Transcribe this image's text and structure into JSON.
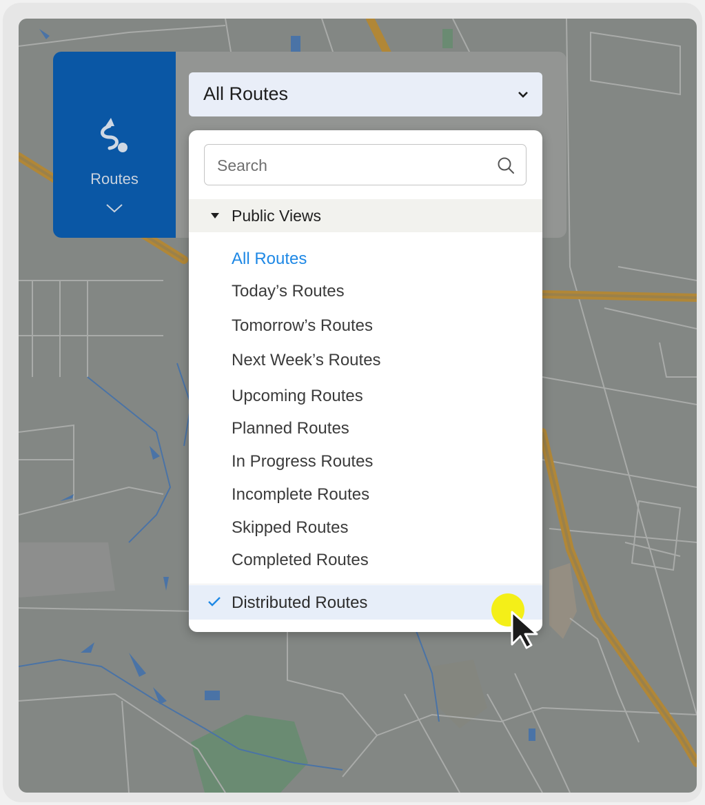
{
  "panel": {
    "tab_label": "Routes",
    "tab_icon": "route-icon",
    "tab_chevron_icon": "chevron-down-icon"
  },
  "select": {
    "value": "All Routes",
    "chevron_icon": "chevron-down-icon"
  },
  "dropdown": {
    "search_placeholder": "Search",
    "search_icon": "search-icon",
    "group_label": "Public Views",
    "options": [
      "All Routes",
      "Today’s Routes",
      "Tomorrow’s Routes",
      "Next Week’s Routes",
      "Upcoming Routes",
      "Planned Routes",
      "In Progress Routes",
      "Incomplete Routes",
      "Skipped Routes",
      "Completed Routes"
    ],
    "active_option": "All Routes",
    "selected_option": "Distributed Routes",
    "check_icon": "check-icon"
  },
  "colors": {
    "accent": "#1e88e5",
    "panel_tab": "#0a57a5",
    "highlight": "#f4ef18"
  }
}
